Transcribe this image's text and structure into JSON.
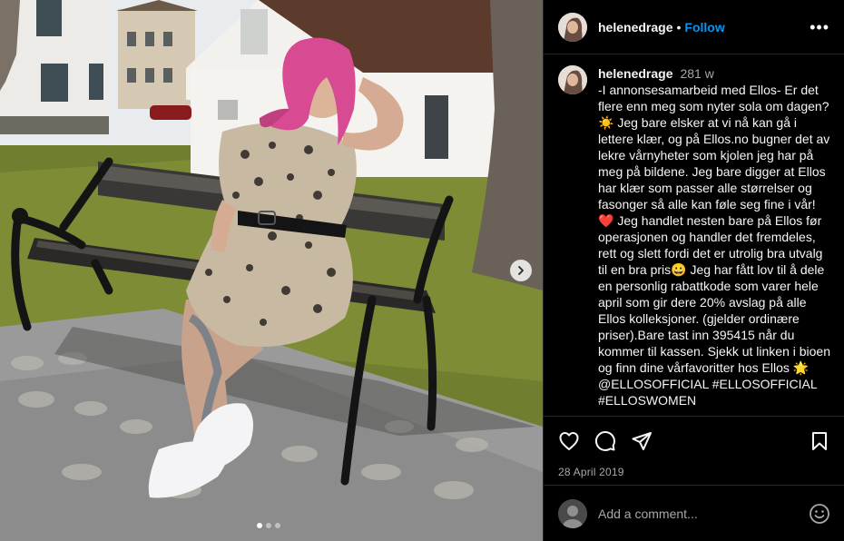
{
  "post": {
    "username": "helenedrage",
    "follow_label": "Follow",
    "separator": "•",
    "more_label": "•••",
    "age": "281 w",
    "caption": "-I annonsesamarbeid med Ellos- Er det flere enn meg som nyter sola om dagen? ☀️ Jeg bare elsker at vi nå kan gå i lettere klær, og på Ellos.no bugner det av lekre vårnyheter som kjolen jeg har på meg på bildene. Jeg bare digger at Ellos har klær som passer alle størrelser og fasonger så alle kan føle seg fine i vår! ❤️ Jeg handlet nesten bare på Ellos før operasjonen og handler det fremdeles, rett og slett fordi det er utrolig bra utvalg til en bra pris😀 Jeg har fått lov til å dele en personlig rabattkode som varer hele april som gir dere 20% avslag på alle Ellos kolleksjoner. (gjelder ordinære priser).Bare tast inn 395415 når du kommer til kassen. Sjekk ut linken i bioen og finn dine vårfavoritter hos Ellos 🌟 @ELLOSOFFICIAL #ELLOSOFFICIAL #ELLOSWOMEN",
    "date": "28 April 2019",
    "comment_placeholder": "Add a comment...",
    "carousel": {
      "total": 3,
      "active": 1
    }
  },
  "icons": {
    "like": "heart-icon",
    "comment": "comment-icon",
    "share": "share-icon",
    "save": "bookmark-icon",
    "emoji": "emoji-icon",
    "next": "chevron-right-icon"
  },
  "colors": {
    "background": "#000000",
    "follow": "#0095f6",
    "secondary_text": "#a8a8a8",
    "divider": "#262626"
  }
}
